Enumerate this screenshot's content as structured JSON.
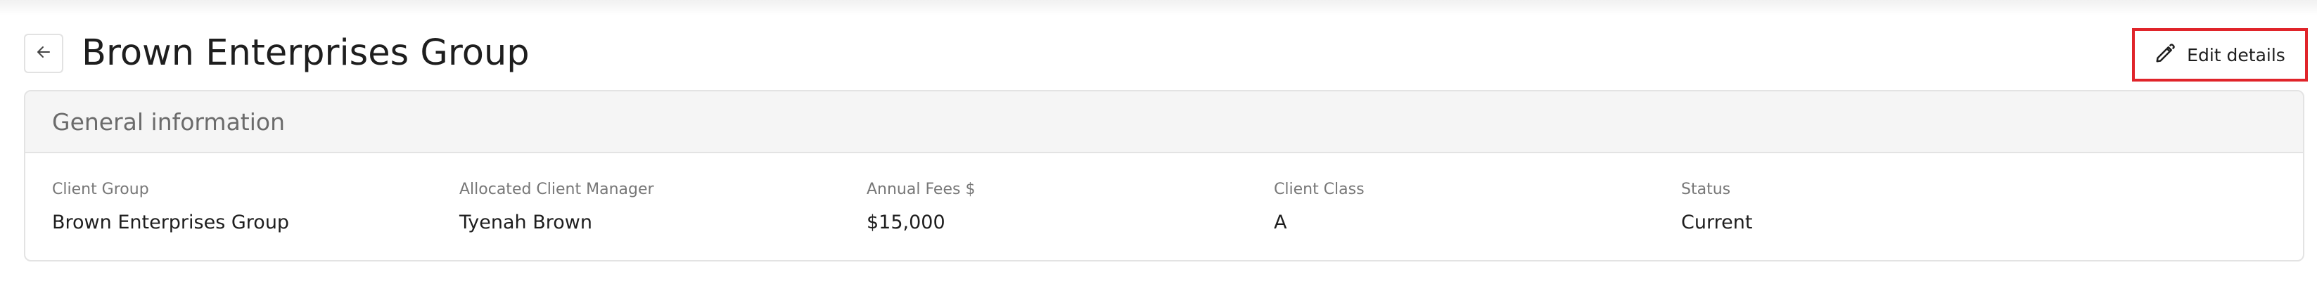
{
  "header": {
    "title": "Brown Enterprises Group",
    "back_icon": "arrow-left-icon",
    "edit_icon": "pencil-icon",
    "edit_label": "Edit details",
    "highlight_color": "#e0242a"
  },
  "general_info": {
    "title": "General information",
    "fields": [
      {
        "label": "Client Group",
        "value": "Brown Enterprises Group"
      },
      {
        "label": "Allocated Client Manager",
        "value": "Tyenah Brown"
      },
      {
        "label": "Annual Fees $",
        "value": "$15,000"
      },
      {
        "label": "Client Class",
        "value": "A"
      },
      {
        "label": "Status",
        "value": "Current"
      }
    ]
  }
}
